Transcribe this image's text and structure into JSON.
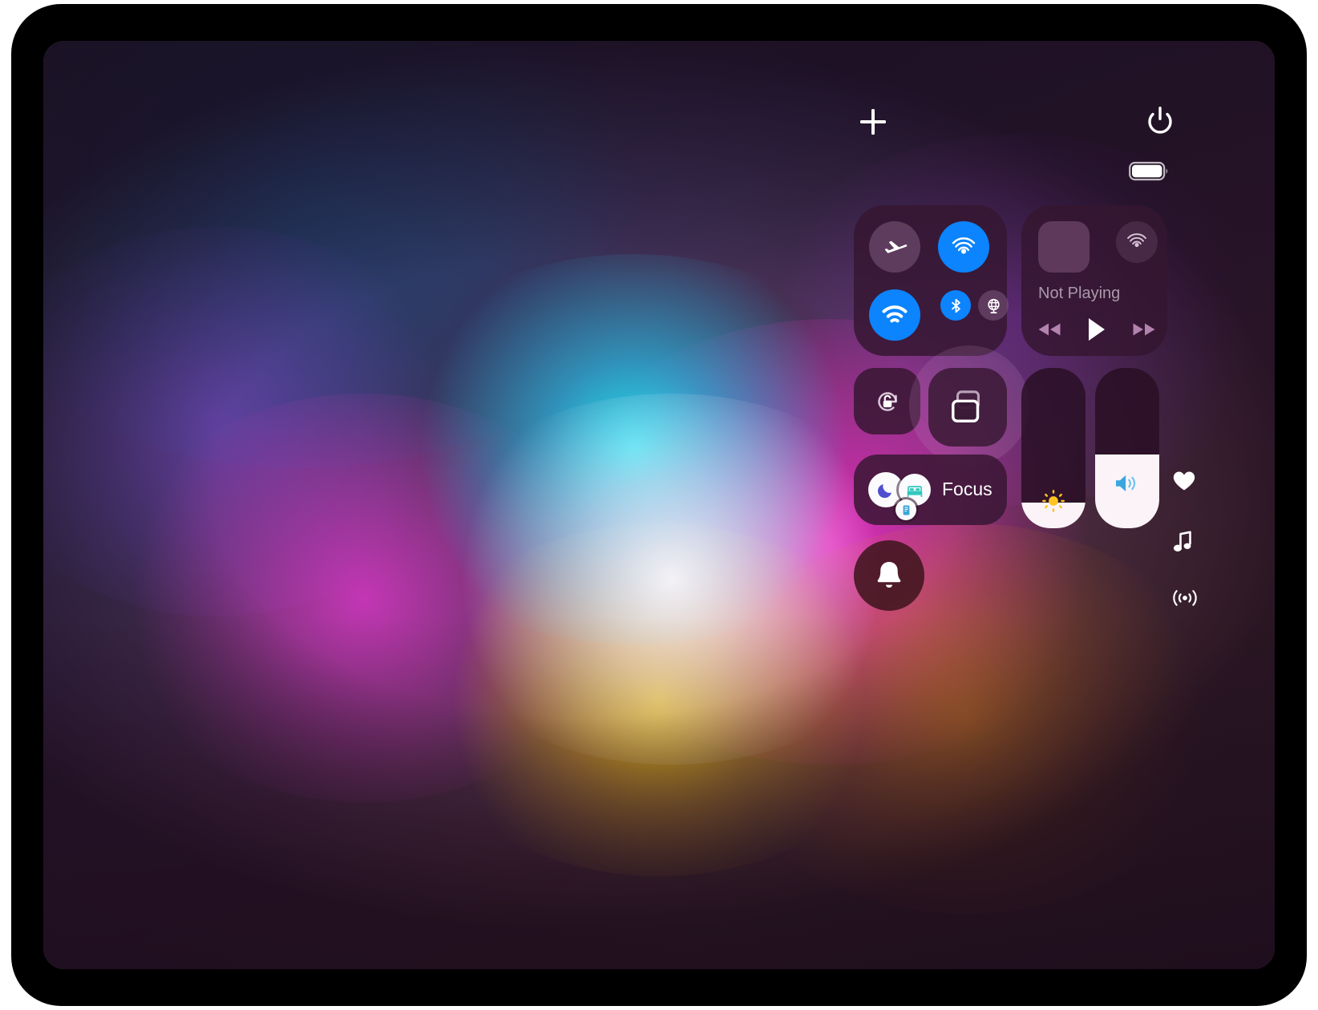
{
  "device": {
    "name": "ipad-tablet"
  },
  "status_bar": {
    "add_widget_label": "+",
    "add_widget_icon": "plus-icon",
    "power_icon": "power-icon",
    "battery_icon": "battery-full-icon",
    "battery_level": "100"
  },
  "control_center": {
    "connectivity": {
      "name": "connectivity-module",
      "buttons": [
        {
          "id": "airplane-mode",
          "icon": "airplane-icon",
          "label": "Airplane Mode",
          "state": "off"
        },
        {
          "id": "airdrop",
          "icon": "airdrop-icon",
          "label": "AirDrop",
          "state": "on"
        },
        {
          "id": "wifi",
          "icon": "wifi-icon",
          "label": "Wi-Fi",
          "state": "on"
        },
        {
          "id": "bluetooth",
          "icon": "bluetooth-icon",
          "label": "Bluetooth",
          "state": "on"
        },
        {
          "id": "cellular",
          "icon": "globe-icon",
          "label": "Cellular Data",
          "state": "off"
        }
      ]
    },
    "media": {
      "name": "now-playing-module",
      "title": "Not Playing",
      "artwork_icon": "album-artwork-placeholder",
      "airplay_icon": "airplay-audio-icon",
      "controls": [
        {
          "id": "rewind",
          "icon": "rewind-icon",
          "label": "Rewind"
        },
        {
          "id": "play",
          "icon": "play-icon",
          "label": "Play"
        },
        {
          "id": "forward",
          "icon": "fast-forward-icon",
          "label": "Fast Forward"
        }
      ]
    },
    "rotation_lock": {
      "name": "rotation-lock-button",
      "icon": "rotation-lock-icon",
      "label": "Rotation Lock",
      "state": "off"
    },
    "screen_mirroring": {
      "name": "screen-mirroring-button",
      "icon": "screen-mirroring-icon",
      "label": "Screen Mirroring",
      "highlighted": "true"
    },
    "focus": {
      "name": "focus-module",
      "label": "Focus",
      "icons": [
        {
          "id": "do-not-disturb",
          "icon": "moon-icon",
          "color": "#4f4fd0"
        },
        {
          "id": "sleep",
          "icon": "bed-icon",
          "color": "#32c8be"
        },
        {
          "id": "reading",
          "icon": "book-icon",
          "color": "#3aa6d8"
        }
      ]
    },
    "notifications": {
      "name": "notifications-button",
      "icon": "bell-icon",
      "label": "Notifications"
    },
    "brightness": {
      "name": "brightness-slider",
      "icon": "brightness-icon",
      "label": "Brightness",
      "value": 16
    },
    "volume": {
      "name": "volume-slider",
      "icon": "volume-icon",
      "label": "Volume",
      "value": 46
    }
  },
  "edge_controls": [
    {
      "id": "heart",
      "icon": "heart-icon",
      "label": "Favorite"
    },
    {
      "id": "music",
      "icon": "music-note-icon",
      "label": "Music"
    },
    {
      "id": "broadcast",
      "icon": "broadcast-icon",
      "label": "Broadcast"
    }
  ],
  "colors": {
    "accent_blue": "#0b84fe",
    "panel_bg": "#341630",
    "slider_fill": "#fbf3f8",
    "brightness_yellow": "#ffc41f",
    "volume_blue": "#3aa6e0",
    "bell_bg": "#40161e"
  }
}
